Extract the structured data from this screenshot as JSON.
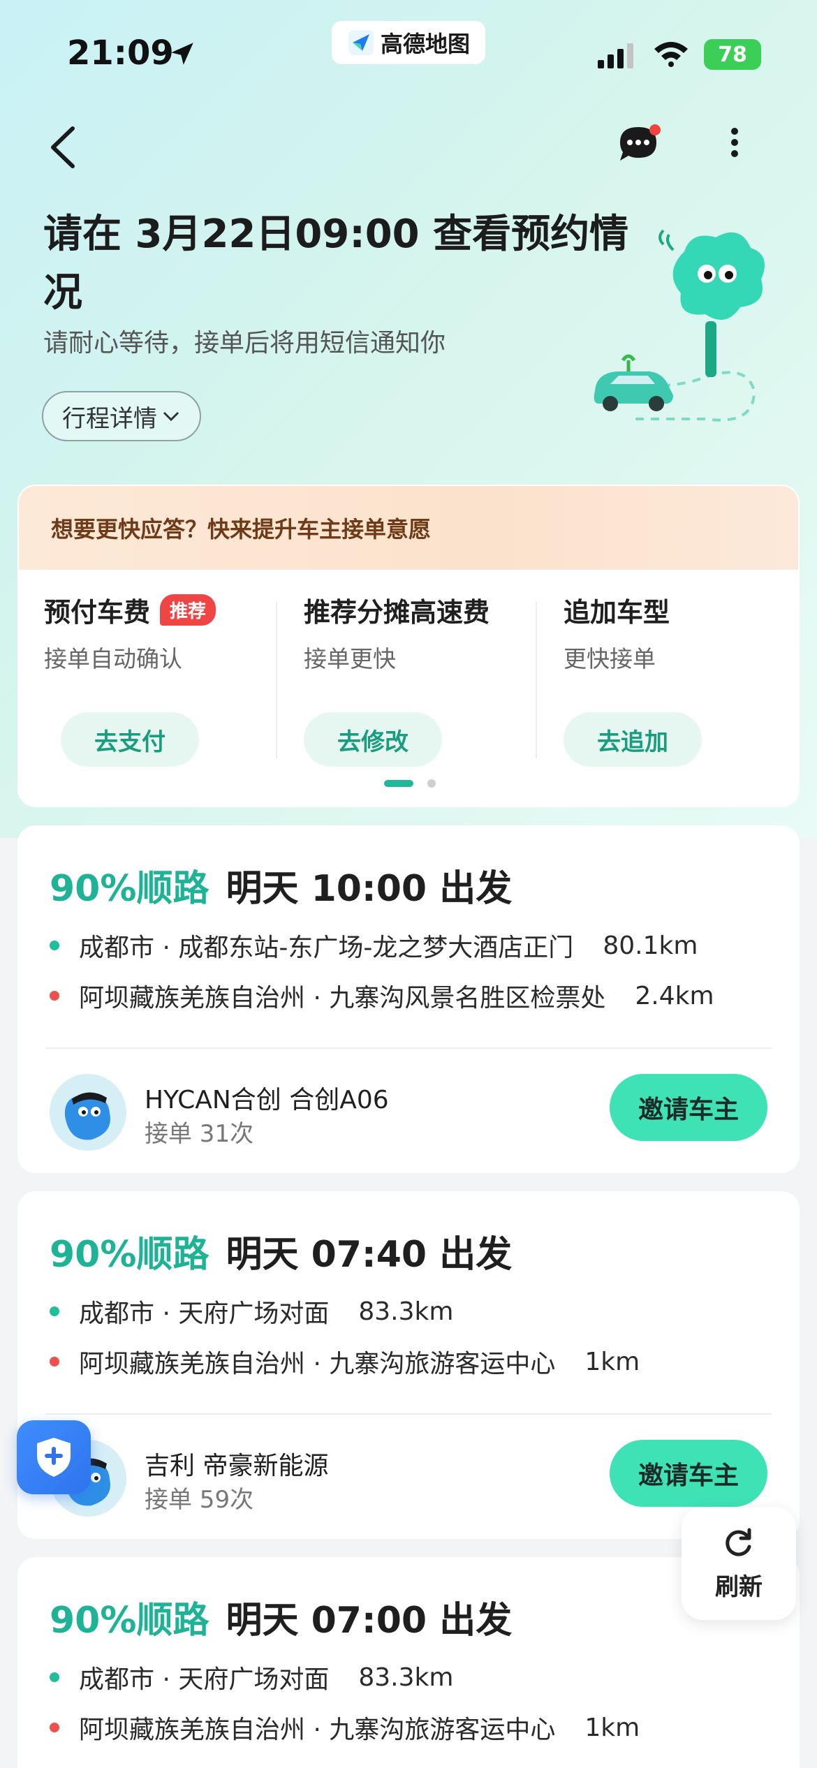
{
  "status_bar": {
    "time": "21:09",
    "app_name": "高德地图",
    "battery": "78"
  },
  "header": {
    "title": "请在 3月22日09:00 查看预约情况",
    "subtitle": "请耐心等待，接单后将用短信通知你",
    "trip_detail_label": "行程详情"
  },
  "promo": {
    "banner_text": "想要更快应答？快来提升车主接单意愿",
    "items": [
      {
        "title": "预付车费",
        "badge": "推荐",
        "subtitle": "接单自动确认",
        "button": "去支付"
      },
      {
        "title": "推荐分摊高速费",
        "subtitle": "接单更快",
        "button": "去修改"
      },
      {
        "title": "追加车型",
        "subtitle": "更快接单",
        "button": "去追加"
      }
    ]
  },
  "rides": [
    {
      "match": "90%顺路",
      "depart": "明天 10:00 出发",
      "from": "成都市 · 成都东站-东广场-龙之梦大酒店正门",
      "from_km": "80.1km",
      "to": "阿坝藏族羌族自治州 · 九寨沟风景名胜区检票处",
      "to_km": "2.4km",
      "car": "HYCAN合创 合创A06",
      "orders": "接单 31次",
      "button": "邀请车主"
    },
    {
      "match": "90%顺路",
      "depart": "明天 07:40 出发",
      "from": "成都市 · 天府广场对面",
      "from_km": "83.3km",
      "to": "阿坝藏族羌族自治州 · 九寨沟旅游客运中心",
      "to_km": "1km",
      "car": "吉利 帝豪新能源",
      "orders": "接单 59次",
      "button": "邀请车主"
    },
    {
      "match": "90%顺路",
      "depart": "明天 07:00 出发",
      "from": "成都市 · 天府广场对面",
      "from_km": "83.3km",
      "to": "阿坝藏族羌族自治州 · 九寨沟旅游客运中心",
      "to_km": "1km"
    }
  ],
  "refresh_label": "刷新",
  "colors": {
    "accent_green": "#1eb396",
    "invite_button": "#3ee2b4",
    "badge_red": "#f04545",
    "shield_blue": "#3f8dfd"
  }
}
